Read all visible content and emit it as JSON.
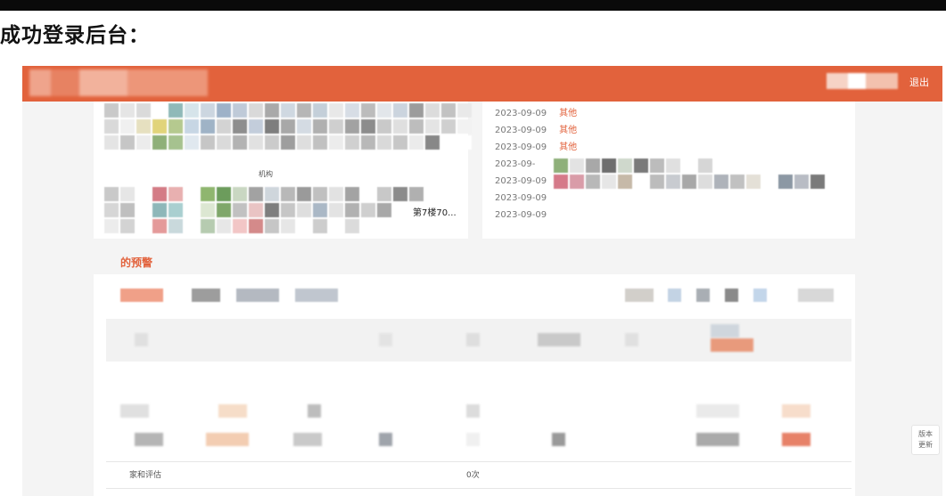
{
  "caption": "成功登录后台：",
  "header": {
    "logout_label": "退出",
    "brand_color": "#e2623c"
  },
  "upper_left_card": {
    "mid_label": "机构",
    "item_label": "第7楼70..."
  },
  "news_list": {
    "rows": [
      {
        "date": "2023-09-09",
        "tag": "其他"
      },
      {
        "date": "2023-09-09",
        "tag": "其他"
      },
      {
        "date": "2023-09-09",
        "tag": "其他"
      },
      {
        "date": "2023-09-",
        "tag": ""
      },
      {
        "date": "2023-09-09",
        "tag": ""
      },
      {
        "date": "2023-09-09",
        "tag": ""
      },
      {
        "date": "2023-09-09",
        "tag": ""
      }
    ]
  },
  "warning_section": {
    "title": "的预警",
    "row_label": "家和评估",
    "mid_value": "0次"
  },
  "side_widget": {
    "line1": "版本",
    "line2": "更新"
  }
}
